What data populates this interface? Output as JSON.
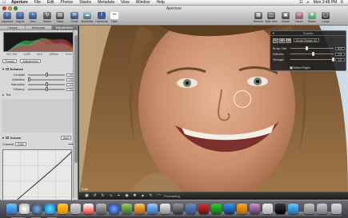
{
  "menubar": {
    "apple": "",
    "items": [
      "Aperture",
      "File",
      "Edit",
      "Photos",
      "Stacks",
      "Metadata",
      "View",
      "Window",
      "Help"
    ],
    "clock": "Mon 3:48 PM"
  },
  "window": {
    "title": "Aperture"
  },
  "toolbar": {
    "left_tools": [
      {
        "label": "Inspector",
        "icon": "inspector-icon"
      },
      {
        "label": "Import",
        "icon": "import-icon"
      },
      {
        "label": "New",
        "icon": "new-icon"
      },
      {
        "label": "Rotate",
        "icon": "rotate-icon"
      },
      {
        "label": "Stack",
        "icon": "stack-icon"
      },
      {
        "label": "Email",
        "icon": "email-icon"
      },
      {
        "label": "MobileMe",
        "icon": "cloud-icon"
      },
      {
        "label": "Facebook",
        "icon": "facebook-icon"
      },
      {
        "label": "Flickr",
        "icon": "flickr-icon"
      }
    ],
    "right_tools": [
      {
        "label": "Browser",
        "icon": "browser-icon"
      },
      {
        "label": "Split View",
        "icon": "split-view-icon"
      },
      {
        "label": "Viewer",
        "icon": "viewer-icon"
      },
      {
        "label": "Faces",
        "icon": "faces-icon"
      },
      {
        "label": "Places",
        "icon": "places-icon"
      },
      {
        "label": "Loupe",
        "icon": "loupe-icon"
      }
    ]
  },
  "inspector": {
    "tabs": [
      {
        "label": "Library",
        "active": false
      },
      {
        "label": "Metadata",
        "active": false
      },
      {
        "label": "Adjustments",
        "active": true
      }
    ],
    "histogram_info": [
      "ISO 100",
      "1/125",
      "f/4.0",
      "105mm",
      "+0 ev"
    ],
    "presets_label": "Presets",
    "adjustments_label": "Adjustments",
    "enhance": {
      "title": "Enhance",
      "rows": [
        {
          "name": "Contrast",
          "value": "0.0",
          "level": 0.5
        },
        {
          "name": "Definition",
          "value": "0.0",
          "level": 0.0
        },
        {
          "name": "Saturation",
          "value": "1.0",
          "level": 0.5
        },
        {
          "name": "Vibrancy",
          "value": "0.0",
          "level": 0.5
        }
      ]
    },
    "tint_label": "Tint",
    "curves": {
      "title": "Curves",
      "auto": "Auto",
      "channel_label": "Channel:",
      "channel_value": "RGB",
      "range_label": "Range:",
      "range_value": "Normal",
      "input_label": "In:",
      "input_value": "0.664",
      "output_label": "Out:",
      "output_value": "0.560"
    }
  },
  "viewer": {
    "image_name": "Kate",
    "status": "Processing"
  },
  "hud": {
    "title": "Curves",
    "brush_range": "Brush Range: All",
    "rows": [
      {
        "name": "Brush Size",
        "value": "30.0",
        "level": 0.35
      },
      {
        "name": "Softness",
        "value": "0.5",
        "level": 0.5
      },
      {
        "name": "Strength",
        "value": "1.0",
        "level": 1.0
      }
    ],
    "detect_edges": "Detect Edges"
  },
  "colors": {
    "accent": "#2f4f7f",
    "histogram_red": "#d04040",
    "histogram_green": "#50c050",
    "histogram_blue": "#4a6ad8"
  }
}
